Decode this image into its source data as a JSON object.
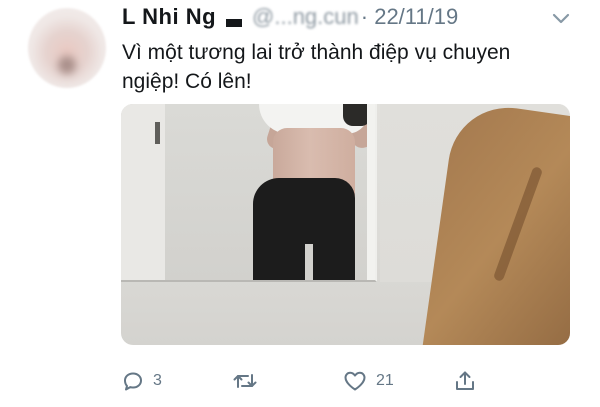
{
  "tweet": {
    "display_name": "L Nhi Ng",
    "handle": "@...ng.cun",
    "time": "· 22/11/19",
    "text": "Vì một tương lai trở thành điệp vụ chuyen ngiệp! Có lên!",
    "media_alt": "photo"
  },
  "actions": {
    "reply_count": "3",
    "retweet_count": "",
    "like_count": "21"
  },
  "icons": {
    "reply": "reply-icon",
    "retweet": "retweet-icon",
    "like": "heart-icon",
    "share": "share-icon",
    "caret": "chevron-down-icon"
  },
  "colors": {
    "icon_gray": "#657786",
    "text": "#14171a"
  }
}
